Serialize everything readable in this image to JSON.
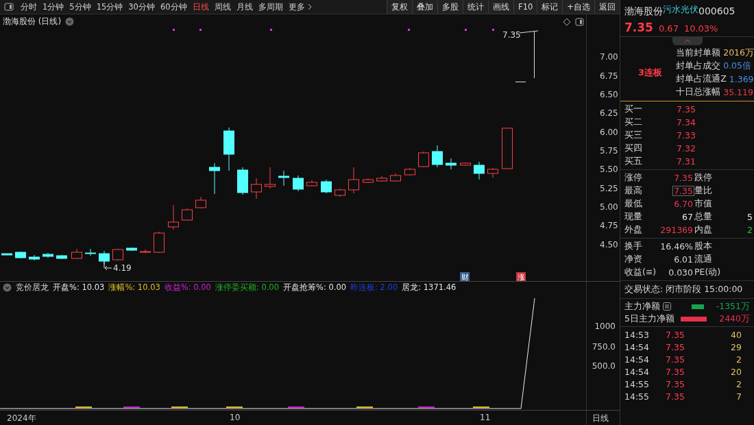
{
  "toolbar": {
    "periods": [
      {
        "label": "分时",
        "selected": false
      },
      {
        "label": "1分钟",
        "selected": false
      },
      {
        "label": "5分钟",
        "selected": false
      },
      {
        "label": "15分钟",
        "selected": false
      },
      {
        "label": "30分钟",
        "selected": false
      },
      {
        "label": "60分钟",
        "selected": false
      },
      {
        "label": "日线",
        "selected": true
      },
      {
        "label": "周线",
        "selected": false
      },
      {
        "label": "月线",
        "selected": false
      },
      {
        "label": "多周期",
        "selected": false
      }
    ],
    "more": "更多",
    "buttons": [
      "复权",
      "叠加",
      "多股",
      "统计",
      "画线",
      "F10",
      "标记",
      "+自选",
      "返回"
    ]
  },
  "chart": {
    "title": "渤海股份 (日线)",
    "y_labels": [
      "7.00",
      "6.75",
      "6.50",
      "6.25",
      "6.00",
      "5.75",
      "5.50",
      "5.25",
      "5.00",
      "4.75",
      "4.50"
    ],
    "high_label": "7.35",
    "low_label": "4.19",
    "markers": [
      {
        "label": "财",
        "color": "#3a5f8f"
      },
      {
        "label": "涨",
        "color": "#c8323c"
      }
    ]
  },
  "indicator": {
    "name": "竞价居龙",
    "items": [
      {
        "label": "开盘%: 10.03",
        "color": "#e6e6e6"
      },
      {
        "label": "涨幅%: 10.03",
        "color": "#e0c020"
      },
      {
        "label": "收益%: 0.00",
        "color": "#d020d0"
      },
      {
        "label": "涨停委买额: 0.00",
        "color": "#20b020"
      },
      {
        "label": "开盘抢筹%: 0.00",
        "color": "#e6e6e6"
      },
      {
        "label": "昨连板: 2.00",
        "color": "#2040e0"
      },
      {
        "label": "居龙: 1371.46",
        "color": "#e6e6e6"
      }
    ],
    "y_labels": [
      "1000",
      "750.0",
      "500.0"
    ]
  },
  "x_axis": {
    "labels": [
      "2024年",
      "10",
      "11"
    ],
    "period": "日线"
  },
  "quote": {
    "name": "渤海股份",
    "concept": "污水光伏",
    "code": "000605",
    "price": "7.35",
    "change": "0.67",
    "percent": "10.03%",
    "streak": "3连板",
    "seal": [
      {
        "label": "当前封单额",
        "value": "2016万",
        "color": "#e8c060"
      },
      {
        "label": "封单占成交",
        "value": "0.05倍",
        "color": "#4a90e0"
      },
      {
        "label": "封单占流通Z",
        "value": "1.369",
        "color": "#4a90e0"
      },
      {
        "label": "十日总涨幅",
        "value": "35.119",
        "color": "#e83a4a"
      }
    ],
    "bids": [
      {
        "label": "买一",
        "price": "7.35"
      },
      {
        "label": "买二",
        "price": "7.34"
      },
      {
        "label": "买三",
        "price": "7.33"
      },
      {
        "label": "买四",
        "price": "7.32"
      },
      {
        "label": "买五",
        "price": "7.31"
      }
    ],
    "stats": [
      [
        {
          "label": "涨停",
          "value": "7.35",
          "color": "#e83a4a",
          "boxed": false
        },
        {
          "label": "跌停"
        }
      ],
      [
        {
          "label": "最高",
          "value": "7.35",
          "color": "#e83a4a",
          "boxed": true
        },
        {
          "label": "量比"
        }
      ],
      [
        {
          "label": "最低",
          "value": "6.70",
          "color": "#e83a4a",
          "boxed": false
        },
        {
          "label": "市值"
        }
      ],
      [
        {
          "label": "现量",
          "value": "67",
          "color": "#e6e6e6",
          "boxed": false
        },
        {
          "label": "总量",
          "value": "5",
          "color": "#e6e6e6",
          "boxed": false
        }
      ],
      [
        {
          "label": "外盘",
          "value": "291369",
          "color": "#e83a4a",
          "boxed": false
        },
        {
          "label": "内盘",
          "value": "2",
          "color": "#30c040",
          "boxed": false
        }
      ]
    ],
    "finance": [
      [
        {
          "label": "换手",
          "value": "16.46%"
        },
        {
          "label": "股本"
        }
      ],
      [
        {
          "label": "净资",
          "value": "6.01"
        },
        {
          "label": "流通"
        }
      ],
      [
        {
          "label": "收益(≡)",
          "value": "0.030"
        },
        {
          "label": "PE(动)"
        }
      ]
    ],
    "status": "交易状态: 闭市阶段 15:00:00",
    "flows": [
      {
        "label": "主力净额",
        "value": "-1351万",
        "color": "#1aa050",
        "has_menu": true
      },
      {
        "label": "5日主力净额",
        "value": "2440万",
        "color": "#e8304a",
        "has_menu": false
      }
    ],
    "trades": [
      {
        "time": "14:53",
        "price": "7.35",
        "volume": "40"
      },
      {
        "time": "14:54",
        "price": "7.35",
        "volume": "29"
      },
      {
        "time": "14:54",
        "price": "7.35",
        "volume": "2"
      },
      {
        "time": "14:54",
        "price": "7.35",
        "volume": "20"
      },
      {
        "time": "14:55",
        "price": "7.35",
        "volume": "2"
      },
      {
        "time": "14:55",
        "price": "7.35",
        "volume": "7"
      }
    ]
  }
}
